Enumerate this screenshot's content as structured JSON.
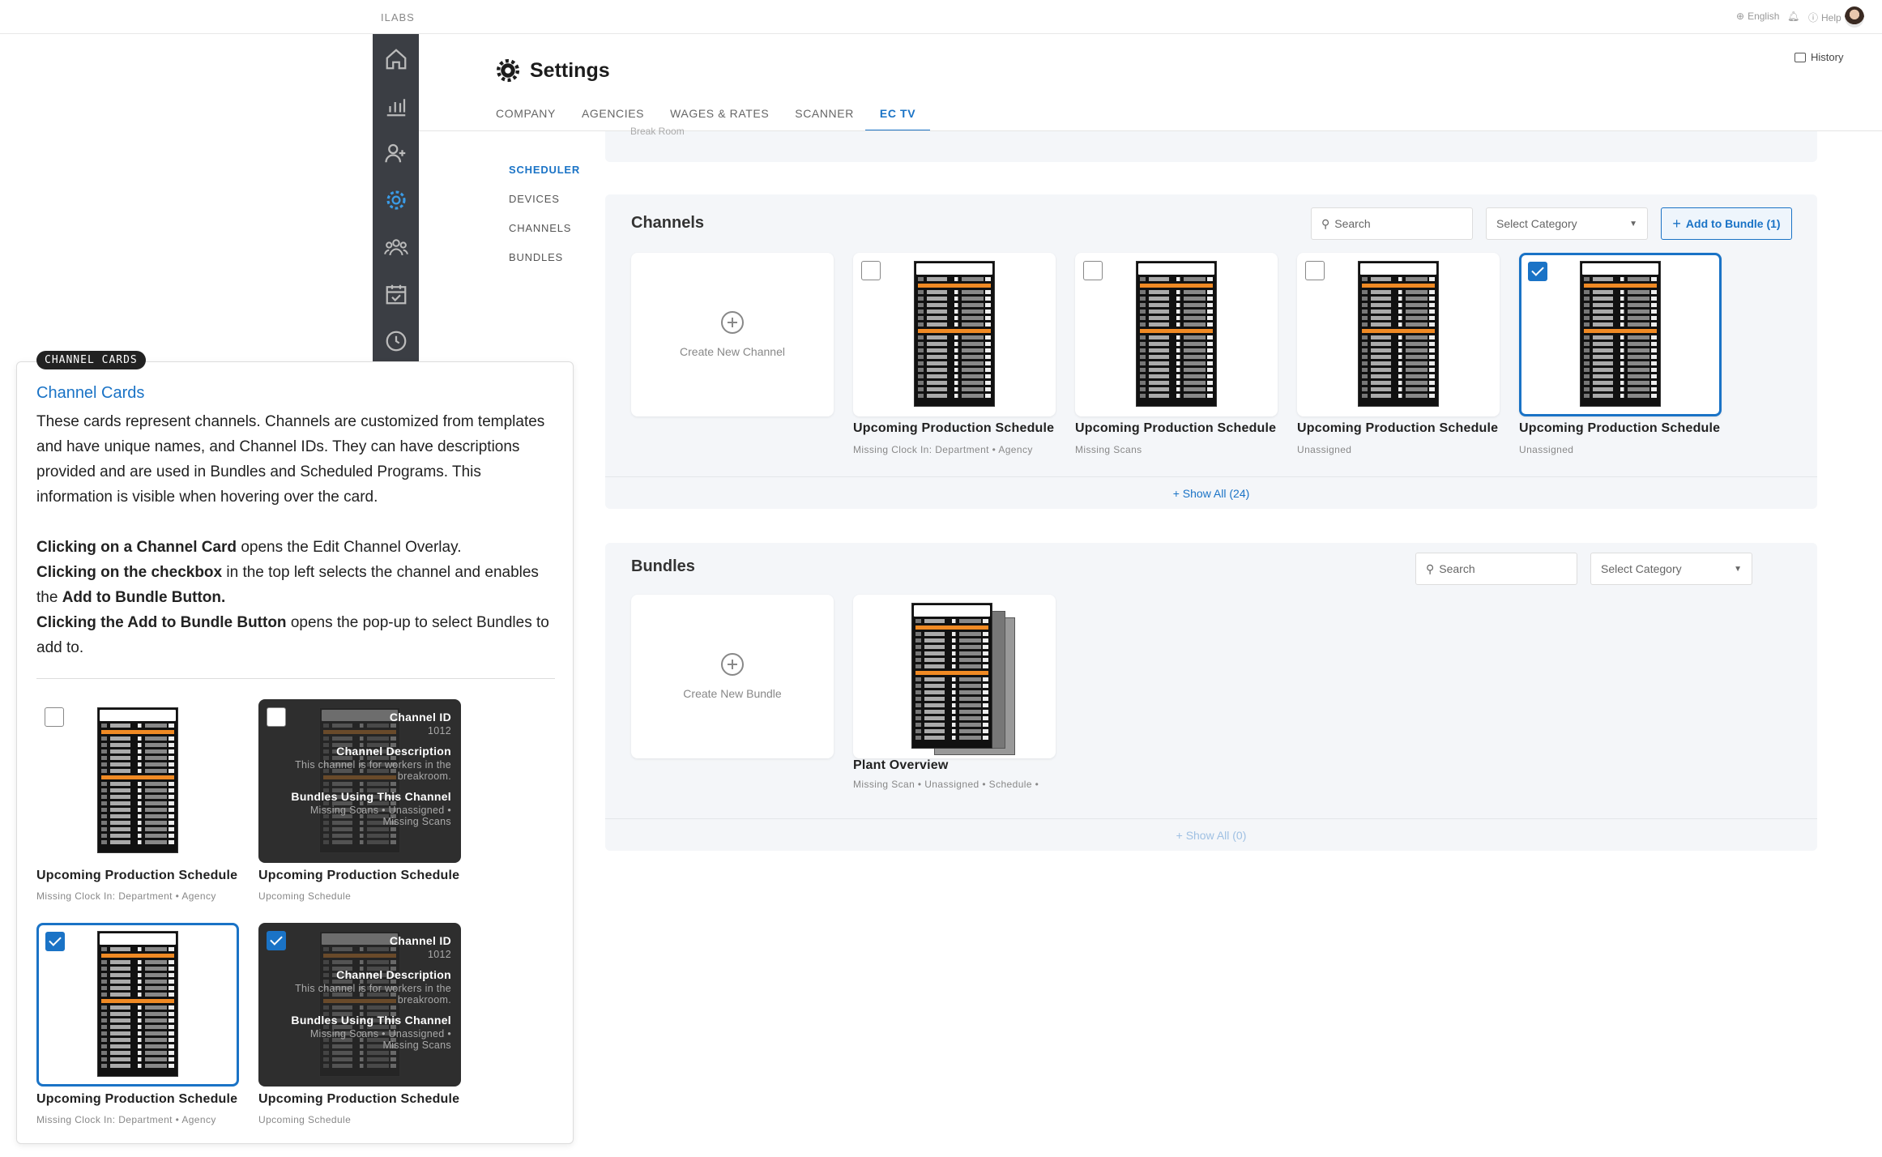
{
  "topbar": {
    "brand": "ILABS",
    "language": "English",
    "help": "Help"
  },
  "header": {
    "title": "Settings",
    "history": "History"
  },
  "tabs": [
    {
      "label": "COMPANY"
    },
    {
      "label": "AGENCIES"
    },
    {
      "label": "WAGES & RATES"
    },
    {
      "label": "SCANNER"
    },
    {
      "label": "EC TV",
      "active": true
    }
  ],
  "subnav": [
    {
      "label": "SCHEDULER",
      "active": true
    },
    {
      "label": "DEVICES"
    },
    {
      "label": "CHANNELS"
    },
    {
      "label": "BUNDLES"
    }
  ],
  "prev_section_text": "Break Room",
  "channels": {
    "title": "Channels",
    "search_placeholder": "Search",
    "category_label": "Select Category",
    "add_bundle_label": "Add to Bundle (1)",
    "create_label": "Create New Channel",
    "cards": [
      {
        "title": "Upcoming Production Schedule",
        "subtitle": "Missing Clock In: Department • Agency",
        "checked": false
      },
      {
        "title": "Upcoming Production Schedule",
        "subtitle": "Missing Scans",
        "checked": false
      },
      {
        "title": "Upcoming Production Schedule",
        "subtitle": "Unassigned",
        "checked": false
      },
      {
        "title": "Upcoming Production Schedule",
        "subtitle": "Unassigned",
        "checked": true
      }
    ],
    "show_all": "Show All (24)"
  },
  "bundles": {
    "title": "Bundles",
    "search_placeholder": "Search",
    "category_label": "Select Category",
    "create_label": "Create New Bundle",
    "cards": [
      {
        "title": "Plant Overview",
        "subtitle": "Missing Scan • Unassigned • Schedule •"
      }
    ],
    "show_all": "Show All (0)"
  },
  "callout": {
    "tag": "CHANNEL CARDS",
    "title": "Channel Cards",
    "paragraph": "These cards represent channels. Channels are customized from templates and have unique names, and Channel IDs. They can have descriptions provided and are used in Bundles and Scheduled Programs. This information is visible when hovering over the card.",
    "line1_bold": "Clicking on a Channel Card",
    "line1_rest": " opens the Edit Channel Overlay.",
    "line2_bold": "Clicking on the checkbox",
    "line2_rest": " in the top left selects the channel and enables the ",
    "line2_bold2": "Add to Bundle Button.",
    "line3_bold": "Clicking the Add to Bundle Button",
    "line3_rest": " opens the pop-up to select Bundles to add to.",
    "examples": [
      {
        "title": "Upcoming Production Schedule",
        "subtitle": "Missing Clock In: Department • Agency",
        "state": "default"
      },
      {
        "title": "Upcoming Production Schedule",
        "subtitle": "Upcoming Schedule",
        "state": "hover"
      },
      {
        "title": "Upcoming Production Schedule",
        "subtitle": "Missing Clock In: Department • Agency",
        "state": "selected"
      },
      {
        "title": "Upcoming Production Schedule",
        "subtitle": "Upcoming Schedule",
        "state": "hover-selected"
      }
    ],
    "hover": {
      "id_label": "Channel ID",
      "id_value": "1012",
      "desc_label": "Channel Description",
      "desc_value": "This channel is for workers in the breakroom.",
      "bundles_label": "Bundles Using This Channel",
      "bundles_value": "Missing Scans • Unassigned • Missing Scans"
    }
  },
  "colors": {
    "accent": "#1a73c6",
    "sidebar": "#3b3e44",
    "panel": "#f4f6f9",
    "highlight": "#f08a24"
  }
}
